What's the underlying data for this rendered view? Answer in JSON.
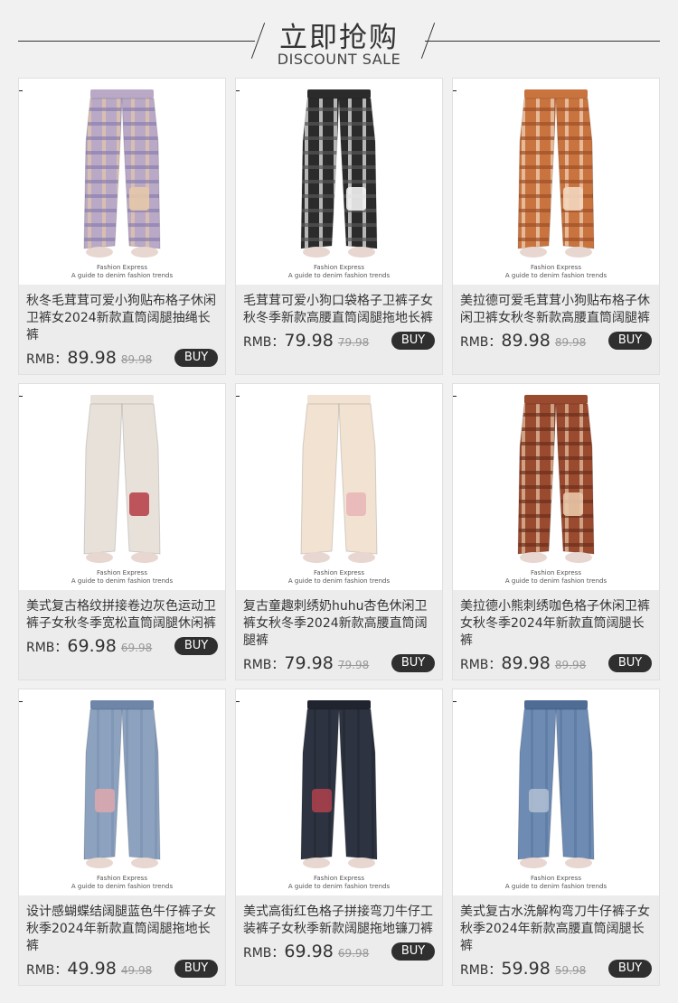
{
  "header": {
    "title": "立即抢购",
    "subtitle": "DISCOUNT SALE"
  },
  "brand_line1": "Fashion Express",
  "brand_line2": "A guide to denim fashion trends",
  "price_label": "RMB：",
  "buy_label": "BUY",
  "products": [
    {
      "name": "秋冬毛茸茸可爱小狗贴布格子休闲卫裤女2024新款直筒阔腿抽绳长裤",
      "price": "89.98",
      "old_price": "89.98",
      "colors": [
        "#b9a9c6",
        "#e6c8a9",
        "#8a7fb0"
      ],
      "pattern": "plaid"
    },
    {
      "name": "毛茸茸可爱小狗口袋格子卫裤子女秋冬季新款高腰直筒阔腿拖地长裤",
      "price": "79.98",
      "old_price": "79.98",
      "colors": [
        "#2b2b2b",
        "#f2f2f2",
        "#555555"
      ],
      "pattern": "plaid"
    },
    {
      "name": "美拉德可爱毛茸茸小狗贴布格子休闲卫裤女秋冬新款高腰直筒阔腿裤",
      "price": "89.98",
      "old_price": "89.98",
      "colors": [
        "#c9743f",
        "#f3d7bf",
        "#9d4f26"
      ],
      "pattern": "plaid"
    },
    {
      "name": "美式复古格纹拼接卷边灰色运动卫裤子女秋冬季宽松直筒阔腿休闲裤",
      "price": "69.98",
      "old_price": "69.98",
      "colors": [
        "#e7e1da",
        "#b8454c",
        "#d6cfc6"
      ],
      "pattern": "solid"
    },
    {
      "name": "复古童趣刺绣奶huhu杏色休闲卫裤女秋冬季2024新款高腰直筒阔腿裤",
      "price": "79.98",
      "old_price": "79.98",
      "colors": [
        "#f2e2d2",
        "#e8b8b8",
        "#e6d4c2"
      ],
      "pattern": "solid"
    },
    {
      "name": "美拉德小熊刺绣咖色格子休闲卫裤女秋冬季2024年新款直筒阔腿长裤",
      "price": "89.98",
      "old_price": "89.98",
      "colors": [
        "#9a4a2f",
        "#e8c7a7",
        "#6b2f1c"
      ],
      "pattern": "plaid"
    },
    {
      "name": "设计感蝴蝶结阔腿蓝色牛仔裤子女秋季2024年新款直筒阔腿拖地长裤",
      "price": "49.98",
      "old_price": "49.98",
      "colors": [
        "#8da2bf",
        "#d9a7ad",
        "#6f86a8"
      ],
      "pattern": "denim"
    },
    {
      "name": "美式高街红色格子拼接弯刀牛仔工装裤子女秋季新款阔腿拖地镰刀裤",
      "price": "69.98",
      "old_price": "69.98",
      "colors": [
        "#2d3340",
        "#a8404c",
        "#1f242e"
      ],
      "pattern": "denim"
    },
    {
      "name": "美式复古水洗解构弯刀牛仔裤子女秋季2024年新款高腰直筒阔腿长裤",
      "price": "59.98",
      "old_price": "59.98",
      "colors": [
        "#6d8bb3",
        "#aebdd1",
        "#4f6c94"
      ],
      "pattern": "denim"
    }
  ]
}
